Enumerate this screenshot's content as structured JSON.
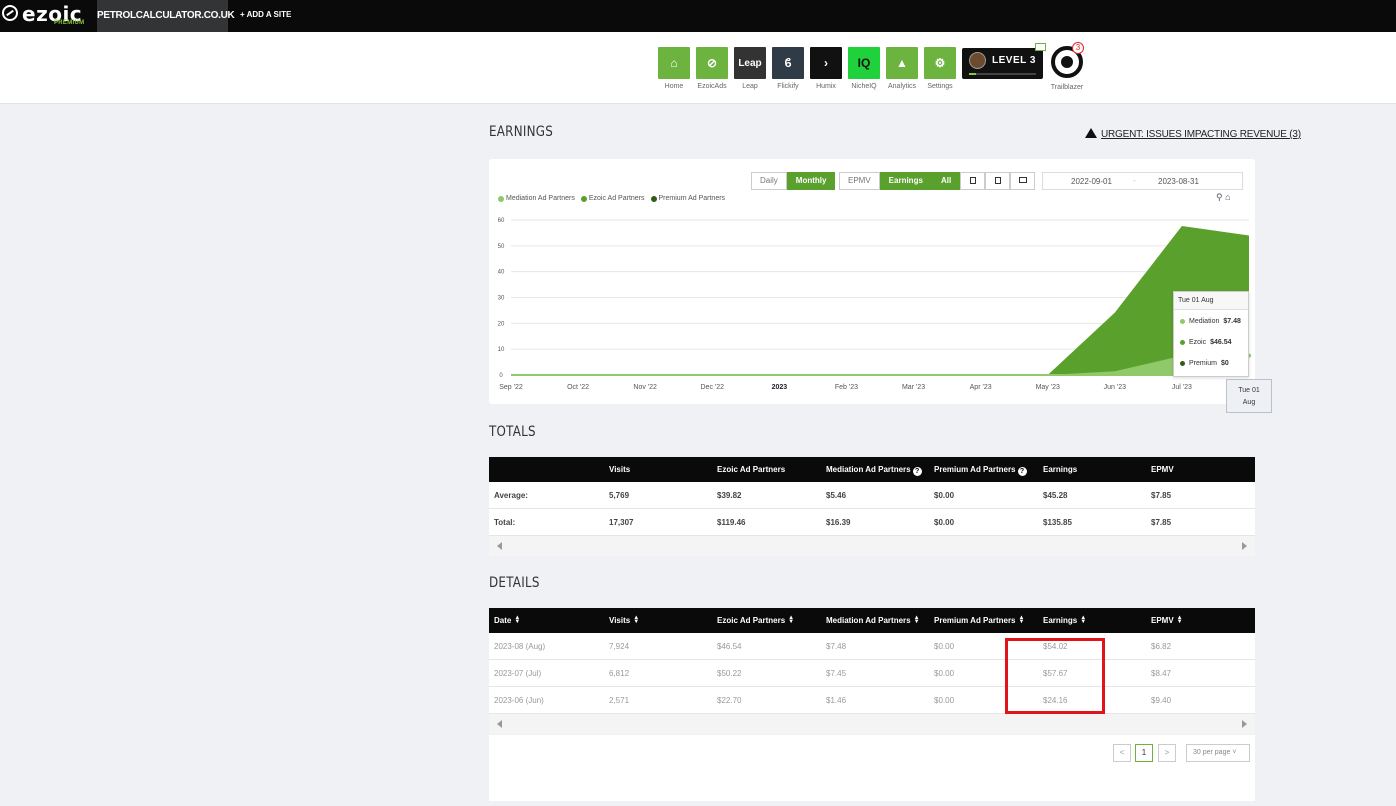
{
  "topbar": {
    "logo": "ezoic",
    "logo_sub": "PREMIUM",
    "site": "PETROLCALCULATOR.CO.UK",
    "add_site": "+ ADD A SITE"
  },
  "apps": [
    {
      "label": "Home",
      "icon": "home-icon",
      "glyph": "⌂",
      "bg": "#6cb33f"
    },
    {
      "label": "EzoicAds",
      "icon": "ezoicads-icon",
      "glyph": "⊘",
      "bg": "#6cb33f"
    },
    {
      "label": "Leap",
      "icon": "leap-icon",
      "glyph": "Leap",
      "bg": "#333333"
    },
    {
      "label": "Flickify",
      "icon": "flickify-icon",
      "glyph": "ϐ",
      "bg": "#2f3b47"
    },
    {
      "label": "Humix",
      "icon": "humix-icon",
      "glyph": "›",
      "bg": "#111111"
    },
    {
      "label": "NicheIQ",
      "icon": "nicheiq-icon",
      "glyph": "IQ",
      "bg": "#1fd13a"
    },
    {
      "label": "Analytics",
      "icon": "analytics-icon",
      "glyph": "▲",
      "bg": "#6cb33f"
    },
    {
      "label": "Settings",
      "icon": "settings-icon",
      "glyph": "⚙",
      "bg": "#6cb33f"
    }
  ],
  "level": {
    "label": "LEVEL 3",
    "progress": 0.1
  },
  "trailblazer": {
    "label": "Trailblazer",
    "badge": "3"
  },
  "earnings": {
    "title": "EARNINGS",
    "urgent": "URGENT: ISSUES IMPACTING REVENUE (3)",
    "period_buttons": [
      "Daily",
      "Monthly"
    ],
    "metric_buttons": [
      "EPMV",
      "Earnings"
    ],
    "device_all": "All",
    "date_from": "2022-09-01",
    "date_sep": "-",
    "date_to": "2023-08-31",
    "legend": [
      "Mediation Ad Partners",
      "Ezoic Ad Partners",
      "Premium Ad Partners"
    ],
    "colors": {
      "mediation": "#8fc96a",
      "ezoic": "#5aa02c",
      "premium": "#2f5e17"
    }
  },
  "chart_data": {
    "type": "area",
    "x": [
      "Sep '22",
      "Oct '22",
      "Nov '22",
      "Dec '22",
      "2023",
      "Feb '23",
      "Mar '23",
      "Apr '23",
      "May '23",
      "Jun '23",
      "Jul '23",
      "Aug"
    ],
    "xlabels": [
      "Sep '22",
      "Oct '22",
      "Nov '22",
      "Dec '22",
      "2023",
      "Feb '23",
      "Mar '23",
      "Apr '23",
      "May '23",
      "Jun '23",
      "Jul '23"
    ],
    "series": [
      {
        "name": "Mediation",
        "values": [
          0,
          0,
          0,
          0,
          0,
          0,
          0,
          0,
          0,
          1.46,
          7.45,
          7.48
        ]
      },
      {
        "name": "Ezoic",
        "values": [
          0,
          0,
          0,
          0,
          0,
          0,
          0,
          0,
          0,
          22.7,
          50.22,
          46.54
        ]
      },
      {
        "name": "Premium",
        "values": [
          0,
          0,
          0,
          0,
          0,
          0,
          0,
          0,
          0,
          0,
          0,
          0
        ]
      }
    ],
    "yticks": [
      0,
      10,
      20,
      30,
      40,
      50,
      60
    ],
    "ylim": [
      0,
      60
    ],
    "stacked": true,
    "grid": true
  },
  "tooltip": {
    "title": "Tue 01 Aug",
    "rows": [
      {
        "name": "Mediation",
        "value": "$7.48"
      },
      {
        "name": "Ezoic",
        "value": "$46.54"
      },
      {
        "name": "Premium",
        "value": "$0"
      }
    ],
    "xhover": [
      "Tue 01",
      "Aug"
    ]
  },
  "totals": {
    "title": "TOTALS",
    "headers": [
      "",
      "Visits",
      "Ezoic Ad Partners",
      "Mediation Ad Partners",
      "Premium Ad Partners",
      "Earnings",
      "EPMV"
    ],
    "rows": [
      [
        "Average:",
        "5,769",
        "$39.82",
        "$5.46",
        "$0.00",
        "$45.28",
        "$7.85"
      ],
      [
        "Total:",
        "17,307",
        "$119.46",
        "$16.39",
        "$0.00",
        "$135.85",
        "$7.85"
      ]
    ]
  },
  "details": {
    "title": "DETAILS",
    "headers": [
      "Date",
      "Visits",
      "Ezoic Ad Partners",
      "Mediation Ad Partners",
      "Premium Ad Partners",
      "Earnings",
      "EPMV"
    ],
    "rows": [
      [
        "2023-08 (Aug)",
        "7,924",
        "$46.54",
        "$7.48",
        "$0.00",
        "$54.02",
        "$6.82"
      ],
      [
        "2023-07 (Jul)",
        "6,812",
        "$50.22",
        "$7.45",
        "$0.00",
        "$57.67",
        "$8.47"
      ],
      [
        "2023-06 (Jun)",
        "2,571",
        "$22.70",
        "$1.46",
        "$0.00",
        "$24.16",
        "$9.40"
      ]
    ]
  },
  "pager": {
    "prev": "<",
    "current": "1",
    "next": ">",
    "per_page": "30 per page"
  }
}
